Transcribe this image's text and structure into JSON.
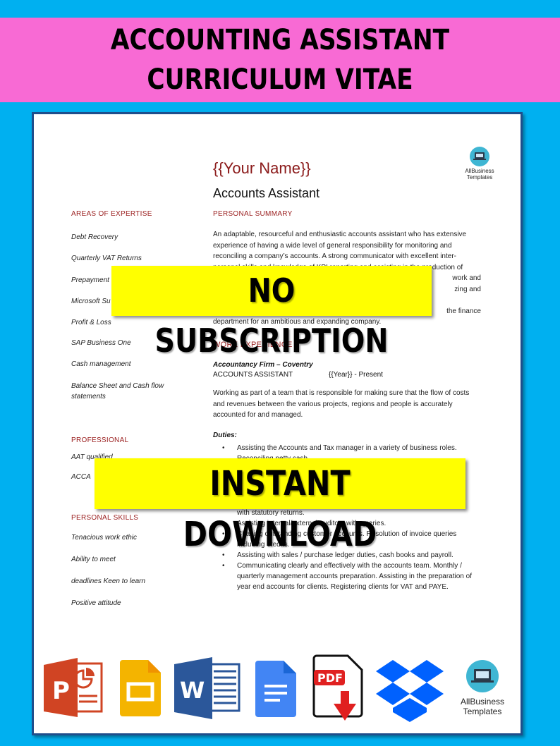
{
  "banner": {
    "line1": "ACCOUNTING ASSISTANT",
    "line2": "CURRICULUM VITAE",
    "bg_color": "#f86ad4",
    "page_bg_color": "#00b0f0"
  },
  "resume": {
    "name": "{{Your Name}}",
    "title": "Accounts Assistant",
    "logo": {
      "icon": "laptop-icon",
      "line1": "AllBusiness",
      "line2": "Templates"
    },
    "sections": {
      "areas_of_expertise": {
        "heading": "AREAS OF EXPERTISE",
        "items": [
          "Debt Recovery",
          "Quarterly VAT Returns",
          "Prepayment",
          "Microsoft Su",
          "Profit & Loss",
          "SAP Business One",
          "Cash management",
          "Balance Sheet and Cash flow statements"
        ]
      },
      "professional": {
        "heading": "PROFESSIONAL",
        "items": [
          "AAT qualified",
          "ACCA"
        ]
      },
      "personal_skills": {
        "heading": "PERSONAL SKILLS",
        "items": [
          "Tenacious work ethic",
          "Ability to meet",
          "deadlines Keen to learn",
          "Positive attitude"
        ]
      },
      "personal_summary": {
        "heading": "PERSONAL SUMMARY",
        "lines": [
          "An adaptable, resourceful and enthusiastic accounts assistant who has extensive",
          "experience of having a wide level of general responsibility for monitoring and",
          "reconciling a company’s accounts. A strong communicator with excellent inter-",
          "personal skills and knowledge of KPI reporting and assisting in the production of",
          "work and",
          "zing and",
          "",
          "the finance",
          "department for an ambitious and expanding company."
        ]
      },
      "work_experience": {
        "heading": "WORK EXPERIENCE",
        "firm": "Accountancy Firm – Coventry",
        "position": "ACCOUNTS ASSISTANT",
        "period": "{{Year}} - Present",
        "description": "Working as part of a team that is responsible for making sure that the flow of costs and revenues between the various projects, regions and people is accurately accounted for and managed.",
        "duties_label": "Duties:",
        "duties": [
          "Assisting the Accounts and Tax manager in a variety of business roles. Reconciling petty cash.",
          "with statutory returns.",
          "Assisting internal/external auditors with queries.",
          "Chasing outstanding customer accounts. Resolution of invoice queries including credits.",
          "Assisting with sales / purchase ledger duties, cash books and payroll.",
          "Communicating clearly and effectively with the accounts team. Monthly / quarterly management accounts preparation. Assisting in the preparation of year end accounts for clients. Registering clients for VAT and PAYE."
        ]
      }
    }
  },
  "stamps": {
    "no_subscription": "NO SUBSCRIPTION",
    "instant_download": "INSTANT DOWNLOAD",
    "color": "#ffff00"
  },
  "format_icons": [
    {
      "name": "powerpoint-icon",
      "letter": "P",
      "color": "#d04423"
    },
    {
      "name": "google-slides-icon",
      "color": "#f4b400"
    },
    {
      "name": "word-icon",
      "letter": "W",
      "color": "#2b579a"
    },
    {
      "name": "google-docs-icon",
      "color": "#4285f4"
    },
    {
      "name": "pdf-download-icon",
      "label": "PDF",
      "color": "#e02020"
    },
    {
      "name": "dropbox-icon",
      "color": "#0061fe"
    },
    {
      "name": "allbusiness-templates-logo",
      "line1": "AllBusiness",
      "line2": "Templates"
    }
  ]
}
